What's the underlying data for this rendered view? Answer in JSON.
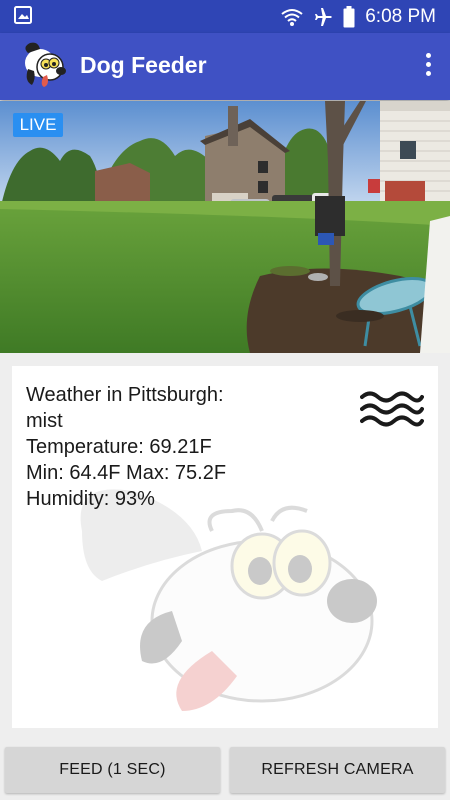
{
  "status_bar": {
    "time": "6:08 PM",
    "icons": [
      "gallery-icon",
      "wifi-icon",
      "airplane-mode-icon",
      "battery-icon"
    ]
  },
  "app_bar": {
    "title": "Dog Feeder",
    "icons": [
      "dog-logo-icon",
      "overflow-menu-icon"
    ]
  },
  "camera": {
    "live_label": "LIVE"
  },
  "weather": {
    "heading": "Weather in Pittsburgh:",
    "condition": "mist",
    "temperature": "Temperature: 69.21F",
    "min_max": "Min: 64.4F Max: 75.2F",
    "humidity": "Humidity: 93%",
    "icon": "mist-icon"
  },
  "actions": {
    "feed_label": "FEED (1 SEC)",
    "refresh_label": "REFRESH CAMERA"
  },
  "colors": {
    "status_bar": "#2f45b5",
    "app_bar": "#3f51c4",
    "live_badge": "#2a8ff1",
    "background": "#eeeeee",
    "button": "#d6d6d6"
  }
}
